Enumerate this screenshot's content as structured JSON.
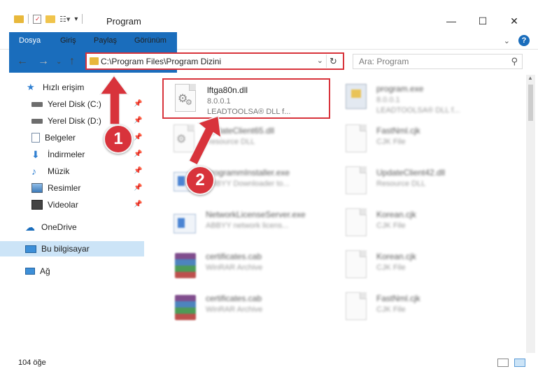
{
  "window": {
    "title": "Program",
    "minimize": "—",
    "maximize": "☐",
    "close": "✕"
  },
  "ribbon": {
    "tabs": [
      "Dosya",
      "Giriş",
      "Paylaş",
      "Görünüm"
    ]
  },
  "address": {
    "path": "C:\\Program Files\\Program Dizini",
    "refresh": "↻"
  },
  "search": {
    "placeholder": "Ara: Program"
  },
  "sidebar": {
    "quick_access": "Hızlı erişim",
    "items": [
      {
        "label": "Yerel Disk (C:)",
        "pinned": true
      },
      {
        "label": "Yerel Disk (D:)",
        "pinned": true
      },
      {
        "label": "Belgeler",
        "pinned": true
      },
      {
        "label": "İndirmeler",
        "pinned": true
      },
      {
        "label": "Müzik",
        "pinned": true
      },
      {
        "label": "Resimler",
        "pinned": true
      },
      {
        "label": "Videolar",
        "pinned": true
      }
    ],
    "onedrive": "OneDrive",
    "this_pc": "Bu bilgisayar",
    "network": "Ağ"
  },
  "files": [
    {
      "name": "lftga80n.dll",
      "line2": "8.0.0.1",
      "line3": "LEADTOOLSA® DLL f...",
      "icon": "dll-icon",
      "highlighted": true
    },
    {
      "name": "program.exe",
      "line2": "8.0.0.1",
      "line3": "LEADTOOLSA® DLL f...",
      "icon": "exe-icon",
      "blurred": true
    },
    {
      "name": "UpdateClient65.dll",
      "line2": "Resource DLL",
      "line3": "",
      "icon": "dll-icon",
      "blurred": true
    },
    {
      "name": "FastNml.cjk",
      "line2": "CJK File",
      "line3": "",
      "icon": "file-icon",
      "blurred": true
    },
    {
      "name": "ProgrammInstaller.exe",
      "line2": "ABBYY Downloader to...",
      "line3": "",
      "icon": "installer-icon",
      "blurred": true
    },
    {
      "name": "UpdateClient42.dll",
      "line2": "Resource DLL",
      "line3": "",
      "icon": "file-icon",
      "blurred": true
    },
    {
      "name": "NetworkLicenseServer.exe",
      "line2": "ABBYY network licens...",
      "line3": "",
      "icon": "installer-icon",
      "blurred": true
    },
    {
      "name": "Korean.cjk",
      "line2": "CJK File",
      "line3": "",
      "icon": "file-icon",
      "blurred": true
    },
    {
      "name": "certificates.cab",
      "line2": "WinRAR Archive",
      "line3": "",
      "icon": "winrar-icon",
      "blurred": true
    },
    {
      "name": "Korean.cjk",
      "line2": "CJK File",
      "line3": "",
      "icon": "file-icon",
      "blurred": true
    },
    {
      "name": "certificates.cab",
      "line2": "WinRAR Archive",
      "line3": "",
      "icon": "winrar-icon",
      "blurred": true
    },
    {
      "name": "FastNml.cjk",
      "line2": "CJK File",
      "line3": "",
      "icon": "file-icon",
      "blurred": true
    }
  ],
  "status": {
    "item_count": "104 öğe"
  },
  "annotations": {
    "step1": "1",
    "step2": "2",
    "accent": "#d8333b"
  }
}
